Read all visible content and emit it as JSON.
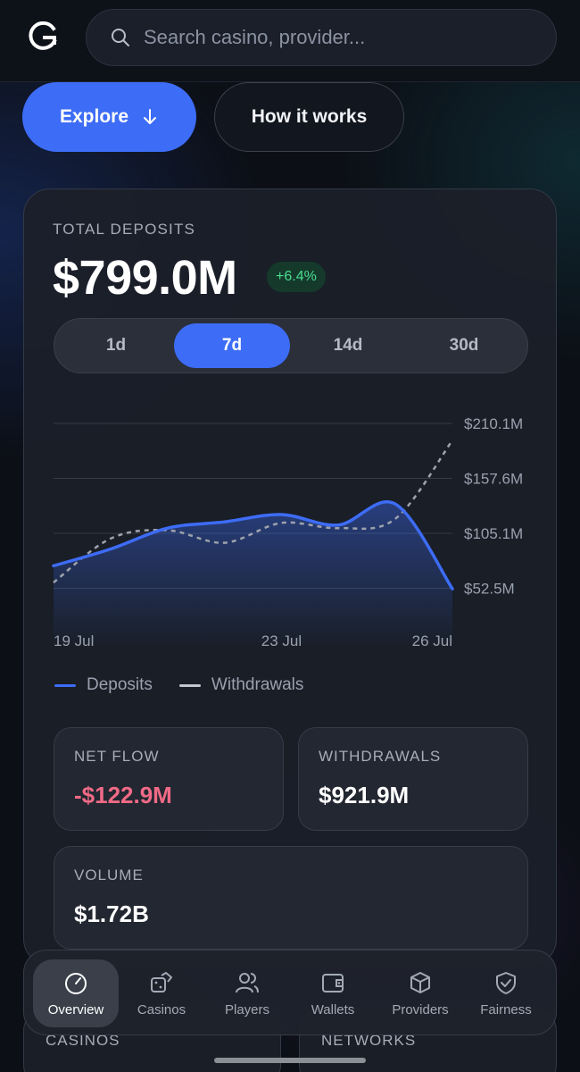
{
  "search": {
    "placeholder": "Search casino, provider..."
  },
  "hero": {
    "explore_label": "Explore",
    "how_label": "How it works"
  },
  "deposits": {
    "label": "TOTAL DEPOSITS",
    "value": "$799.0M",
    "change": "+6.4%",
    "ranges": [
      "1d",
      "7d",
      "14d",
      "30d"
    ],
    "active_range": "7d"
  },
  "chart_data": {
    "type": "line",
    "x": [
      "19 Jul",
      "20 Jul",
      "21 Jul",
      "22 Jul",
      "23 Jul",
      "24 Jul",
      "25 Jul",
      "26 Jul"
    ],
    "x_tick_labels": [
      "19 Jul",
      "23 Jul",
      "26 Jul"
    ],
    "y_tick_labels": [
      "$210.1M",
      "$157.6M",
      "$105.1M",
      "$52.5M"
    ],
    "ylim": [
      0,
      210.1
    ],
    "series": [
      {
        "name": "Deposits",
        "color": "#3d6cf6",
        "style": "solid-area",
        "values": [
          74,
          90,
          110,
          116,
          123,
          113,
          133,
          52
        ]
      },
      {
        "name": "Withdrawals",
        "color": "#9ea3ad",
        "style": "dashed",
        "values": [
          58,
          100,
          108,
          96,
          115,
          110,
          119,
          194
        ]
      }
    ],
    "legend_position": "bottom-left",
    "grid": true
  },
  "stats": {
    "net_flow": {
      "label": "NET FLOW",
      "value": "-$122.9M",
      "color": "#f06a86"
    },
    "withdrawals": {
      "label": "WITHDRAWALS",
      "value": "$921.9M"
    },
    "volume": {
      "label": "VOLUME",
      "value": "$1.72B"
    }
  },
  "nav": {
    "items": [
      {
        "label": "Overview",
        "icon": "gauge-icon"
      },
      {
        "label": "Casinos",
        "icon": "dice-icon"
      },
      {
        "label": "Players",
        "icon": "users-icon"
      },
      {
        "label": "Wallets",
        "icon": "wallet-icon"
      },
      {
        "label": "Providers",
        "icon": "box-icon"
      },
      {
        "label": "Fairness",
        "icon": "shield-check-icon"
      }
    ],
    "active": "Overview"
  },
  "sections": {
    "casinos": "CASINOS",
    "networks": "NETWORKS"
  }
}
